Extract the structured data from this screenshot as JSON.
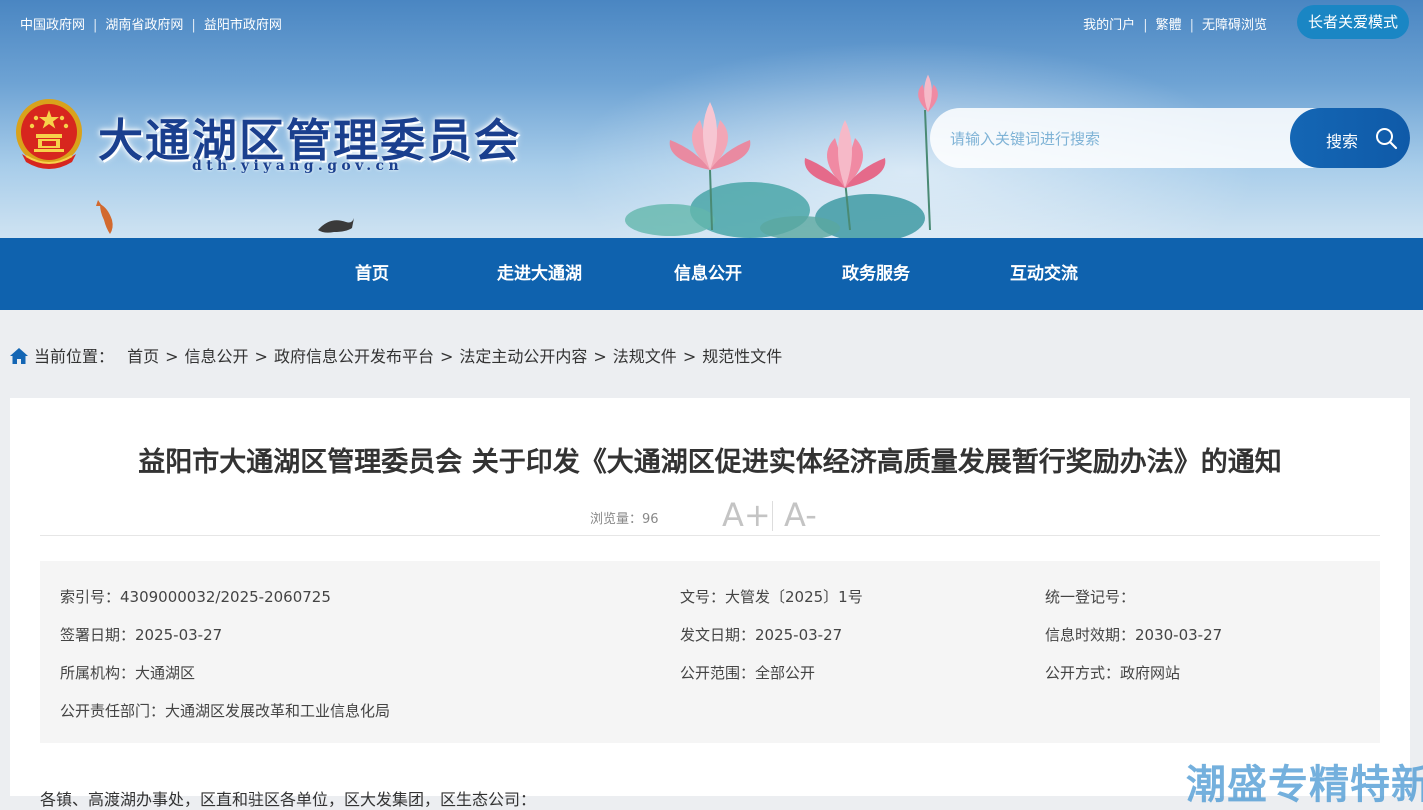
{
  "topbar": {
    "left_links": [
      "中国政府网",
      "湖南省政府网",
      "益阳市政府网"
    ],
    "right_links": [
      "我的门户",
      "繁體",
      "无障碍浏览"
    ],
    "elder_mode": "长者关爱模式"
  },
  "site": {
    "title": "大通湖区管理委员会",
    "domain": "dth.yiyang.gov.cn"
  },
  "search": {
    "placeholder": "请输入关键词进行搜索",
    "button": "搜索"
  },
  "nav": [
    "首页",
    "走进大通湖",
    "信息公开",
    "政务服务",
    "互动交流"
  ],
  "breadcrumb": {
    "label": "当前位置：",
    "items": [
      "首页",
      "信息公开",
      "政府信息公开发布平台",
      "法定主动公开内容",
      "法规文件",
      "规范性文件"
    ],
    "separator": ">"
  },
  "article": {
    "title": "益阳市大通湖区管理委员会 关于印发《大通湖区促进实体经济高质量发展暂行奖励办法》的通知",
    "views": "浏览量：96",
    "font_increase": "A+",
    "font_decrease": "A-",
    "meta": {
      "index_no": "索引号：4309000032/2025-2060725",
      "doc_no": "文号：大管发〔2025〕1号",
      "reg_no": "统一登记号：",
      "sign_date": "签署日期：2025-03-27",
      "issue_date": "发文日期：2025-03-27",
      "valid_until": "信息时效期：2030-03-27",
      "org": "所属机构：大通湖区",
      "scope": "公开范围：全部公开",
      "method": "公开方式：政府网站",
      "dept": "公开责任部门：大通湖区发展改革和工业信息化局"
    },
    "body_first_line": "各镇、高渡湖办事处，区直和驻区各单位，区大发集团，区生态公司："
  },
  "watermark": "潮盛专精特新",
  "colors": {
    "nav_bg": "#0f62ae",
    "title_blue": "#1a3f8e",
    "elder_btn": "#1a86c4"
  }
}
